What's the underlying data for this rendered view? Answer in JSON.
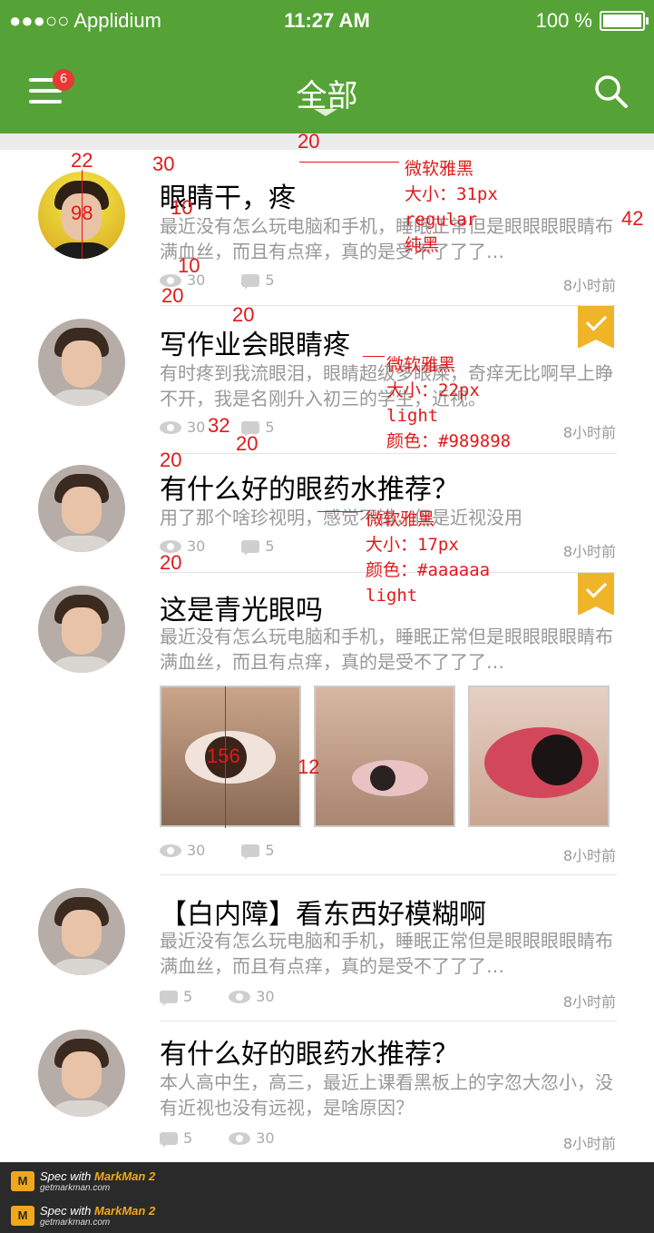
{
  "status_bar": {
    "carrier": "●●●○○ Applidium",
    "time": "11:27 AM",
    "battery": "100 %"
  },
  "nav": {
    "title": "全部",
    "badge_count": "6",
    "menu_icon": "menu-icon",
    "search_icon": "search-icon"
  },
  "colors": {
    "brand_green": "#55a336",
    "body_gray": "#989898",
    "meta_gray": "#aaaaaa",
    "bookmark_yellow": "#f0b428",
    "annotation_red": "#e2181a"
  },
  "posts": [
    {
      "title": "眼睛干，疼",
      "body": "最近没有怎么玩电脑和手机，睡眠正常但是眼眼眼眼睛布满血丝，而且有点痒，真的是受不了了了…",
      "views": "30",
      "comments": "5",
      "time": "8小时前",
      "bookmarked": false
    },
    {
      "title": "写作业会眼睛疼",
      "body": "有时疼到我流眼泪，眼睛超级多眼屎，奇痒无比啊早上睁不开，我是名刚升入初三的学生，近视。",
      "views": "30",
      "comments": "5",
      "time": "8小时前",
      "bookmarked": true
    },
    {
      "title": "有什么好的眼药水推荐？",
      "body": "用了那个啥珍视明，感觉不错，但是近视没用",
      "views": "30",
      "comments": "5",
      "time": "8小时前",
      "bookmarked": false
    },
    {
      "title": "这是青光眼吗",
      "body": "最近没有怎么玩电脑和手机，睡眠正常但是眼眼眼眼睛布满血丝，而且有点痒，真的是受不了了了…",
      "views": "30",
      "comments": "5",
      "time": "8小时前",
      "bookmarked": true
    },
    {
      "title": "【白内障】看东西好模糊啊",
      "body": "最近没有怎么玩电脑和手机，睡眠正常但是眼眼眼眼睛布满血丝，而且有点痒，真的是受不了了了…",
      "comments": "5",
      "views": "30",
      "time": "8小时前",
      "bookmarked": false
    },
    {
      "title": "有什么好的眼药水推荐？",
      "body": "本人高中生，高三，最近上课看黑板上的字忽大忽小，没有近视也没有远视，是啥原因？",
      "comments": "5",
      "views": "30",
      "time": "8小时前",
      "bookmarked": false
    }
  ],
  "annotations": {
    "title_spec": [
      "微软雅黑",
      "大小：31px",
      "regular",
      "纯黑"
    ],
    "body_spec": [
      "微软雅黑",
      "大小：22px",
      "light",
      "颜色：#989898"
    ],
    "meta_spec": [
      "微软雅黑",
      "大小：17px",
      "颜色：#aaaaaa",
      "light"
    ],
    "dims": {
      "d22": "22",
      "d30": "30",
      "d20a": "20",
      "d10a": "10",
      "d98": "98",
      "d42": "42",
      "d10b": "10",
      "d20b": "20",
      "d20c": "20",
      "d32": "32",
      "d20d": "20",
      "d20e": "20",
      "d20f": "20",
      "d156": "156",
      "d12": "12"
    }
  },
  "footer": {
    "brand_prefix": "Spec with",
    "brand_name": "MarkMan 2",
    "site": "getmarkman.com"
  }
}
